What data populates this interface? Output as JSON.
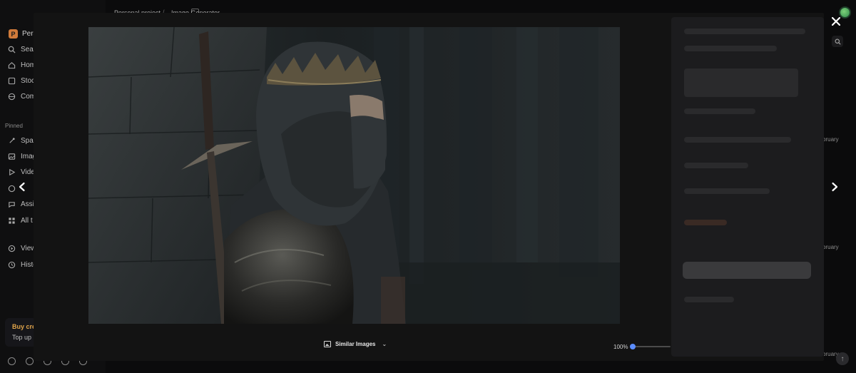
{
  "breadcrumb": {
    "project": "Personal project",
    "page": "Image Generator"
  },
  "brand": {
    "badge": "P",
    "name": "Pers"
  },
  "sidebar": {
    "items": [
      {
        "label": "Sear",
        "icon": "search-icon"
      },
      {
        "label": "Hom",
        "icon": "home-icon"
      },
      {
        "label": "Stoc",
        "icon": "stock-icon"
      },
      {
        "label": "Com",
        "icon": "globe-icon"
      }
    ],
    "pinned_label": "Pinned",
    "pinned": [
      {
        "label": "Spac",
        "icon": "spaces-icon"
      },
      {
        "label": "Imag",
        "icon": "image-icon"
      },
      {
        "label": "Vide",
        "icon": "video-icon"
      },
      {
        "label": "",
        "icon": "audio-icon"
      },
      {
        "label": "Assi",
        "icon": "assistant-icon"
      },
      {
        "label": "All t",
        "icon": "grid-icon"
      }
    ],
    "bottom": [
      {
        "label": "View",
        "icon": "view-icon"
      },
      {
        "label": "Histo",
        "icon": "history-icon"
      }
    ],
    "promo": {
      "title": "Buy cre",
      "subtitle": "Top up"
    }
  },
  "background": {
    "date_stub": "bruary"
  },
  "viewer": {
    "similar_images_label": "Similar Images",
    "zoom_label": "100%",
    "zoom_fraction": 0.05,
    "close_icon": "close-icon",
    "prev_icon": "chevron-left-icon",
    "next_icon": "chevron-right-icon"
  },
  "colors": {
    "accent": "#3d7bff",
    "promo": "#e0a44a",
    "brand": "#d07a3a"
  }
}
